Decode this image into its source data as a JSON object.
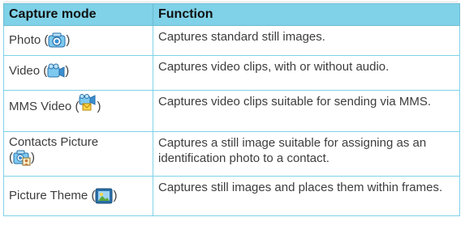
{
  "table": {
    "headers": {
      "mode": "Capture mode",
      "function": "Function"
    },
    "rows": [
      {
        "mode": "Photo",
        "icon": "camera-icon",
        "function": "Captures standard still images."
      },
      {
        "mode": "Video",
        "icon": "video-camera-icon",
        "function": "Captures video clips, with or without audio."
      },
      {
        "mode": "MMS Video",
        "icon": "mms-video-icon",
        "function": "Captures video clips suitable for sending via MMS."
      },
      {
        "mode": "Contacts Picture",
        "icon": "contacts-picture-icon",
        "function": "Captures a still image suitable for assigning as an identification photo to a contact."
      },
      {
        "mode": "Picture Theme",
        "icon": "picture-theme-icon",
        "function": "Captures still images and places them within frames."
      }
    ]
  },
  "punctuation": {
    "open": "(",
    "close": ")"
  },
  "colors": {
    "header_bg": "#7fd2e8",
    "border": "#7fd2e8",
    "text": "#3d3d3d"
  }
}
